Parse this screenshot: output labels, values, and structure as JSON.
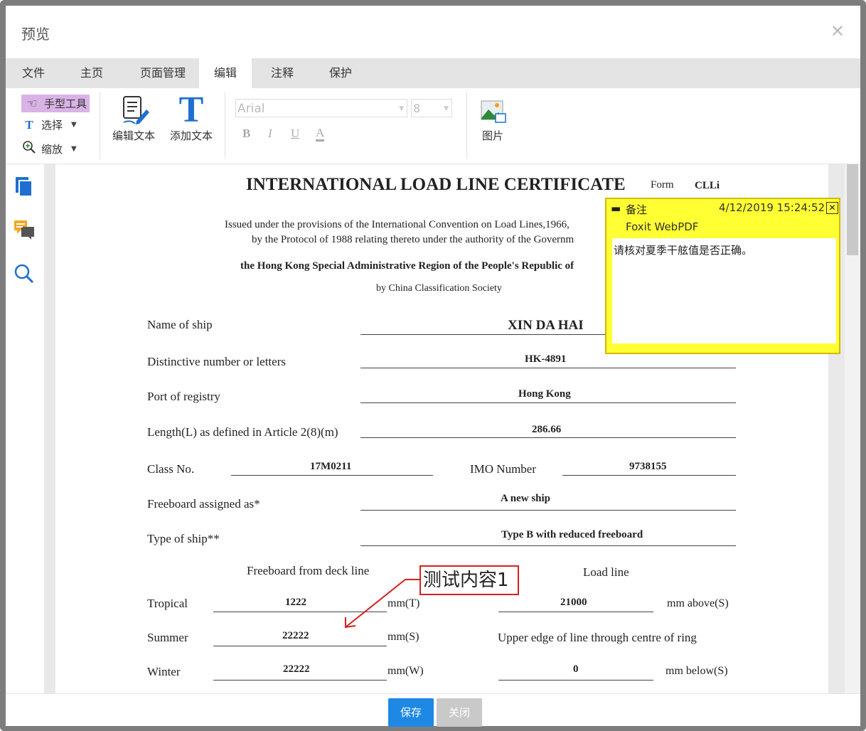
{
  "dialog": {
    "title": "预览",
    "close_icon": "✕"
  },
  "tabs": [
    {
      "label": "文件"
    },
    {
      "label": "主页"
    },
    {
      "label": "页面管理"
    },
    {
      "label": "编辑",
      "active": true
    },
    {
      "label": "注释"
    },
    {
      "label": "保护"
    }
  ],
  "ribbon": {
    "hand_tool": "手型工具",
    "select": "选择",
    "zoom": "缩放",
    "edit_text": "编辑文本",
    "add_text": "添加文本",
    "font_family": "Arial",
    "font_size": "8",
    "bold": "B",
    "italic": "I",
    "underline": "U",
    "font_color": "A",
    "image": "图片"
  },
  "certificate": {
    "title": "INTERNATIONAL LOAD LINE CERTIFICATE",
    "form_label": "Form",
    "form_code": "CLLi",
    "issued_line1": "Issued under the provisions of the International Convention on Load Lines,1966,",
    "issued_line2": "by the Protocol of 1988 relating thereto under the authority of the Governm",
    "region_line": "the Hong Kong Special Administrative Region of the People's Republic of",
    "society_line": "by China Classification Society",
    "name_of_ship_label": "Name of ship",
    "name_of_ship": "XIN DA HAI",
    "distinctive_label": "Distinctive number or letters",
    "distinctive": "HK-4891",
    "port_label": "Port of registry",
    "port": "Hong Kong",
    "length_label": "Length(L) as defined in Article 2(8)(m)",
    "length": "286.66",
    "class_label": "Class No.",
    "class_no": "17M0211",
    "imo_label": "IMO Number",
    "imo": "9738155",
    "freeboard_label": "Freeboard assigned as*",
    "freeboard": "A new ship",
    "type_label": "Type of ship**",
    "type": "Type B with reduced freeboard",
    "freeboard_deck_header": "Freeboard from deck line",
    "load_line_header": "Load line",
    "tropical_label": "Tropical",
    "tropical_value": "1222",
    "tropical_unit": "mm(T)",
    "tropical_load": "21000",
    "tropical_load_unit": "mm above(S)",
    "summer_label": "Summer",
    "summer_value": "22222",
    "summer_unit": "mm(S)",
    "upper_edge": "Upper edge of line through centre of ring",
    "winter_label": "Winter",
    "winter_value": "22222",
    "winter_unit": "mm(W)",
    "winter_load": "0",
    "winter_load_unit": "mm below(S)"
  },
  "sticky_note": {
    "label": "备注",
    "datetime": "4/12/2019 15:24:52",
    "author": "Foxit WebPDF",
    "content": "请核对夏季干舷值是否正确。",
    "close": "✕",
    "bg_color": "#ffff33"
  },
  "annotation": {
    "text": "测试内容1",
    "border_color": "#d62020"
  },
  "footer": {
    "save": "保存",
    "close": "关闭",
    "save_color": "#1e88e5",
    "close_color": "#c9c9c9"
  }
}
